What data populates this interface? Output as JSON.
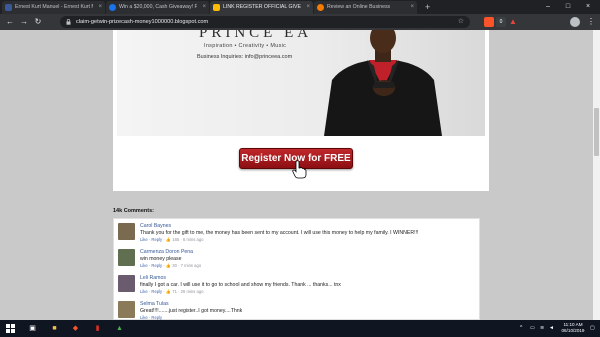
{
  "browser": {
    "tabs": [
      {
        "title": "Ernest Kurt Manuel - Ernest Kurt M...",
        "favicon_color": "#3b5998",
        "active": false
      },
      {
        "title": "Win a $20,000, Cash Giveaway! Pr...",
        "favicon_color": "#1a73e8",
        "active": false
      },
      {
        "title": "LINK REGISTER OFFICIAL GIVEAWAY",
        "favicon_color": "#fbbc04",
        "active": true
      },
      {
        "title": "Review an Online Business",
        "favicon_color": "#f57c00",
        "active": false
      }
    ],
    "new_tab_label": "+",
    "url": "claim-getwin-prizecash-money1000000.blogspot.com",
    "extension_badge": "0"
  },
  "promo": {
    "brand": "PRINCE EA",
    "tagline": "Inspiration • Creativity • Music",
    "business": "Business Inquiries: info@princeea.com"
  },
  "register_button": {
    "label": "Register Now for FREE",
    "color": "#b0191d"
  },
  "comments_count": "14k Comments:",
  "comments": [
    {
      "name": "Carol Baynes",
      "text": "Thank you for the gift to me, the money has been sent to my account. I will use this money to help my family. I WINNER!!!",
      "like": "Like",
      "reply": "Reply",
      "likes": "165",
      "time": "6 mins ago",
      "avatar_color": "#7a6a4f"
    },
    {
      "name": "Carmenza Doron Pena",
      "text": "win money please",
      "like": "Like",
      "reply": "Reply",
      "likes": "30",
      "time": "7 mins ago",
      "avatar_color": "#5f6f4f"
    },
    {
      "name": "Leli Ramos",
      "text": "finally I got a car. I will use it to go to school and show my friends. Thank ... thanks... tnx",
      "like": "Like",
      "reply": "Reply",
      "likes": "71",
      "time": "26 mins ago",
      "avatar_color": "#6b5b6e"
    },
    {
      "name": "Selma Tulas",
      "text": "Great!!!!.......just register..I got money....Thnk",
      "like": "Like",
      "reply": "Reply",
      "likes": "",
      "time": "",
      "avatar_color": "#8a7a5a"
    }
  ],
  "taskbar": {
    "time": "11:10 AM",
    "date": "06/10/2019"
  }
}
